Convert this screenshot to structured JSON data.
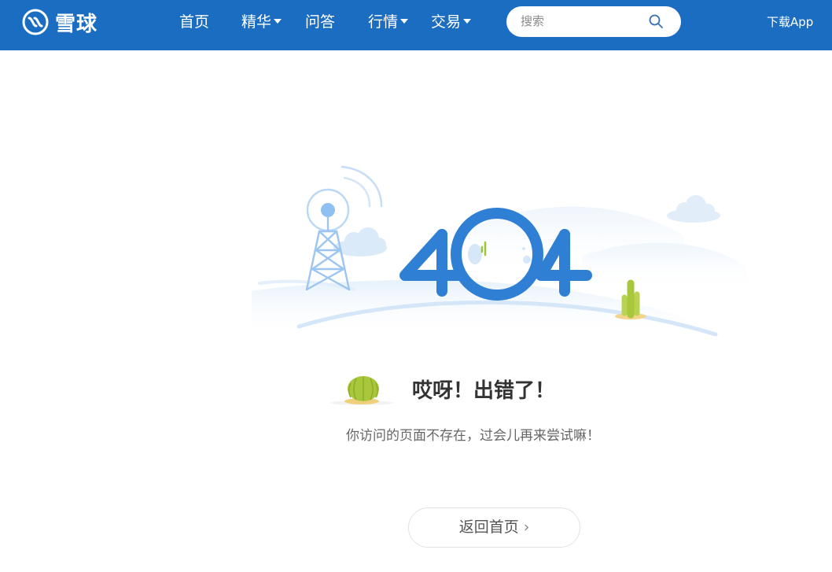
{
  "header": {
    "logo_text": "雪球",
    "nav": [
      {
        "label": "首页",
        "dropdown": false
      },
      {
        "label": "精华",
        "dropdown": true
      },
      {
        "label": "问答",
        "dropdown": false
      },
      {
        "label": "行情",
        "dropdown": true
      },
      {
        "label": "交易",
        "dropdown": true
      }
    ],
    "search_placeholder": "搜索",
    "download_label": "下载App"
  },
  "error": {
    "code": "404",
    "title": "哎呀！出错了！",
    "message": "你访问的页面不存在，过会儿再来尝试嘛！",
    "home_button_label": "返回首页"
  },
  "icons": {
    "logo": "xueqiu-logo-icon",
    "search": "search-icon",
    "chevron": "chevron-right-icon"
  },
  "colors": {
    "header_bg": "#1b6dc1",
    "accent_blue": "#2f7fd4",
    "cactus_green": "#a9c73a"
  }
}
